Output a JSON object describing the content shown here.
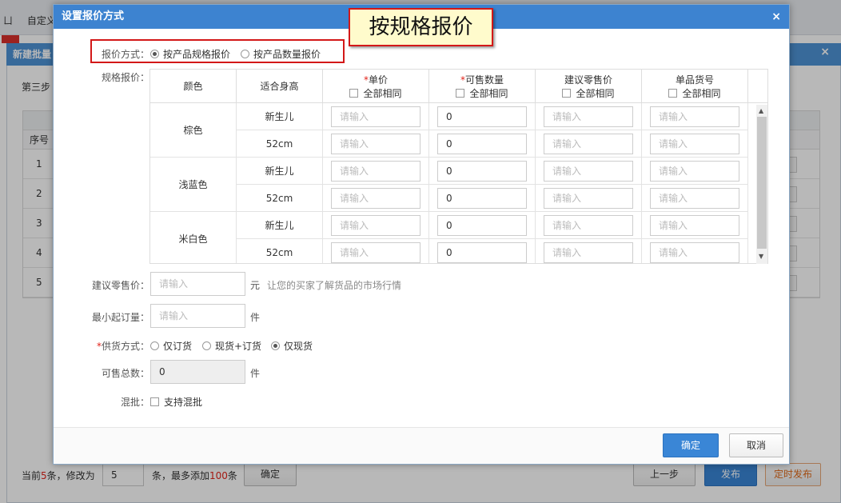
{
  "bg": {
    "menu_text": "自定义",
    "panel_title": "新建批量",
    "step": "第三步",
    "col_index": "序号",
    "rows": [
      "1",
      "2",
      "3",
      "4",
      "5"
    ],
    "footer": {
      "current_prefix": "当前",
      "current_count": "5",
      "current_mid": "条，修改为",
      "modify_value": "5",
      "max_prefix": "条，最多添加",
      "max_count": "100",
      "max_suffix": "条",
      "confirm": "确定",
      "prev": "上一步",
      "publish": "发布",
      "timed_publish": "定时发布"
    }
  },
  "dialog": {
    "title": "设置报价方式",
    "close": "×",
    "annotation": "按规格报价",
    "pricing_mode_label": "报价方式：",
    "pricing_modes": [
      "按产品规格报价",
      "按产品数量报价"
    ],
    "pricing_mode_selected": "按产品规格报价",
    "spec_price_label": "规格报价：",
    "columns": {
      "color": "颜色",
      "size": "适合身高",
      "unit_price": "单价",
      "available_qty": "可售数量",
      "retail_price": "建议零售价",
      "sku": "单品货号",
      "all_same": "全部相同"
    },
    "groups": [
      {
        "color": "棕色",
        "sizes": [
          "新生儿",
          "52cm"
        ]
      },
      {
        "color": "浅蓝色",
        "sizes": [
          "新生儿",
          "52cm"
        ]
      },
      {
        "color": "米白色",
        "sizes": [
          "新生儿",
          "52cm"
        ]
      }
    ],
    "input_placeholder": "请输入",
    "qty_value": "0",
    "retail_label": "建议零售价：",
    "retail_unit": "元",
    "retail_hint": "让您的买家了解货品的市场行情",
    "moq_label": "最小起订量：",
    "moq_unit": "件",
    "supply_label": "供货方式：",
    "supply_options": [
      "仅订货",
      "现货+订货",
      "仅现货"
    ],
    "supply_selected": "仅现货",
    "total_label": "可售总数：",
    "total_value": "0",
    "total_unit": "件",
    "mix_label": "混批：",
    "mix_option": "支持混批",
    "ok": "确定",
    "cancel": "取消"
  }
}
